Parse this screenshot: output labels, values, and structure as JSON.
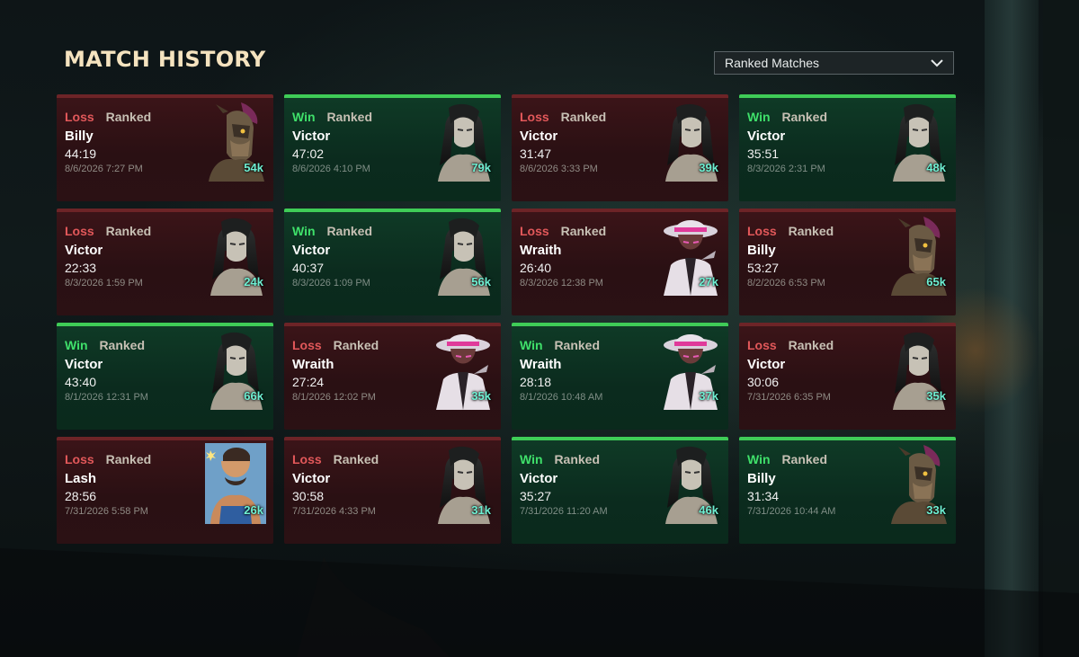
{
  "header": {
    "title": "MATCH HISTORY"
  },
  "filter": {
    "selected": "Ranked Matches",
    "icon": "chevron-down-icon"
  },
  "colors": {
    "win": "#3fe06a",
    "loss": "#e2585a",
    "title": "#f5e3bf",
    "souls": "#6ef0d3"
  },
  "matches": [
    {
      "result": "Loss",
      "mode": "Ranked",
      "hero": "Billy",
      "duration": "44:19",
      "datetime": "8/6/2026 7:27 PM",
      "souls": "54k"
    },
    {
      "result": "Win",
      "mode": "Ranked",
      "hero": "Victor",
      "duration": "47:02",
      "datetime": "8/6/2026 4:10 PM",
      "souls": "79k"
    },
    {
      "result": "Loss",
      "mode": "Ranked",
      "hero": "Victor",
      "duration": "31:47",
      "datetime": "8/6/2026 3:33 PM",
      "souls": "39k"
    },
    {
      "result": "Win",
      "mode": "Ranked",
      "hero": "Victor",
      "duration": "35:51",
      "datetime": "8/3/2026 2:31 PM",
      "souls": "48k"
    },
    {
      "result": "Loss",
      "mode": "Ranked",
      "hero": "Victor",
      "duration": "22:33",
      "datetime": "8/3/2026 1:59 PM",
      "souls": "24k"
    },
    {
      "result": "Win",
      "mode": "Ranked",
      "hero": "Victor",
      "duration": "40:37",
      "datetime": "8/3/2026 1:09 PM",
      "souls": "56k"
    },
    {
      "result": "Loss",
      "mode": "Ranked",
      "hero": "Wraith",
      "duration": "26:40",
      "datetime": "8/3/2026 12:38 PM",
      "souls": "27k"
    },
    {
      "result": "Loss",
      "mode": "Ranked",
      "hero": "Billy",
      "duration": "53:27",
      "datetime": "8/2/2026 6:53 PM",
      "souls": "65k"
    },
    {
      "result": "Win",
      "mode": "Ranked",
      "hero": "Victor",
      "duration": "43:40",
      "datetime": "8/1/2026 12:31 PM",
      "souls": "66k"
    },
    {
      "result": "Loss",
      "mode": "Ranked",
      "hero": "Wraith",
      "duration": "27:24",
      "datetime": "8/1/2026 12:02 PM",
      "souls": "35k"
    },
    {
      "result": "Win",
      "mode": "Ranked",
      "hero": "Wraith",
      "duration": "28:18",
      "datetime": "8/1/2026 10:48 AM",
      "souls": "37k"
    },
    {
      "result": "Loss",
      "mode": "Ranked",
      "hero": "Victor",
      "duration": "30:06",
      "datetime": "7/31/2026 6:35 PM",
      "souls": "35k"
    },
    {
      "result": "Loss",
      "mode": "Ranked",
      "hero": "Lash",
      "duration": "28:56",
      "datetime": "7/31/2026 5:58 PM",
      "souls": "26k"
    },
    {
      "result": "Loss",
      "mode": "Ranked",
      "hero": "Victor",
      "duration": "30:58",
      "datetime": "7/31/2026 4:33 PM",
      "souls": "31k"
    },
    {
      "result": "Win",
      "mode": "Ranked",
      "hero": "Victor",
      "duration": "35:27",
      "datetime": "7/31/2026 11:20 AM",
      "souls": "46k"
    },
    {
      "result": "Win",
      "mode": "Ranked",
      "hero": "Billy",
      "duration": "31:34",
      "datetime": "7/31/2026 10:44 AM",
      "souls": "33k"
    }
  ]
}
